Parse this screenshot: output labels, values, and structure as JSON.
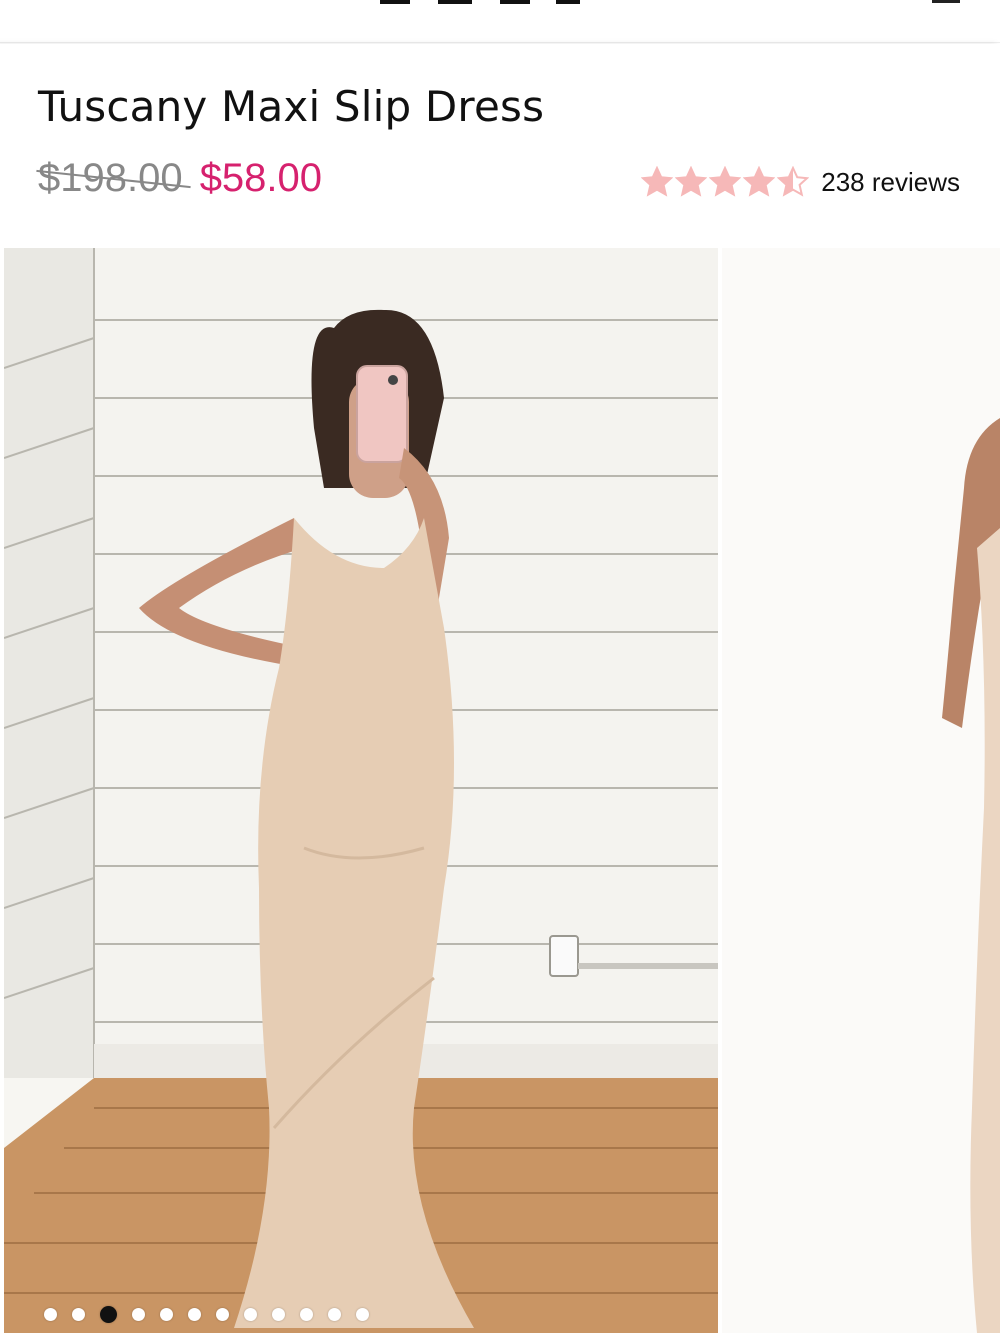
{
  "product": {
    "title": "Tuscany Maxi Slip Dress",
    "original_price": "$198.00",
    "sale_price": "$58.00",
    "rating": 4.5,
    "rating_max": 5,
    "reviews_label": "238 reviews"
  },
  "colors": {
    "sale": "#d6216e",
    "star": "#f6b8b8",
    "strike": "#888888"
  },
  "gallery": {
    "slide_count": 12,
    "active_index": 2,
    "main_image": "model-in-champagne-satin-maxi-slip-dress-mirror-selfie",
    "next_image": "model-in-champagne-slip-dress-white-background"
  }
}
